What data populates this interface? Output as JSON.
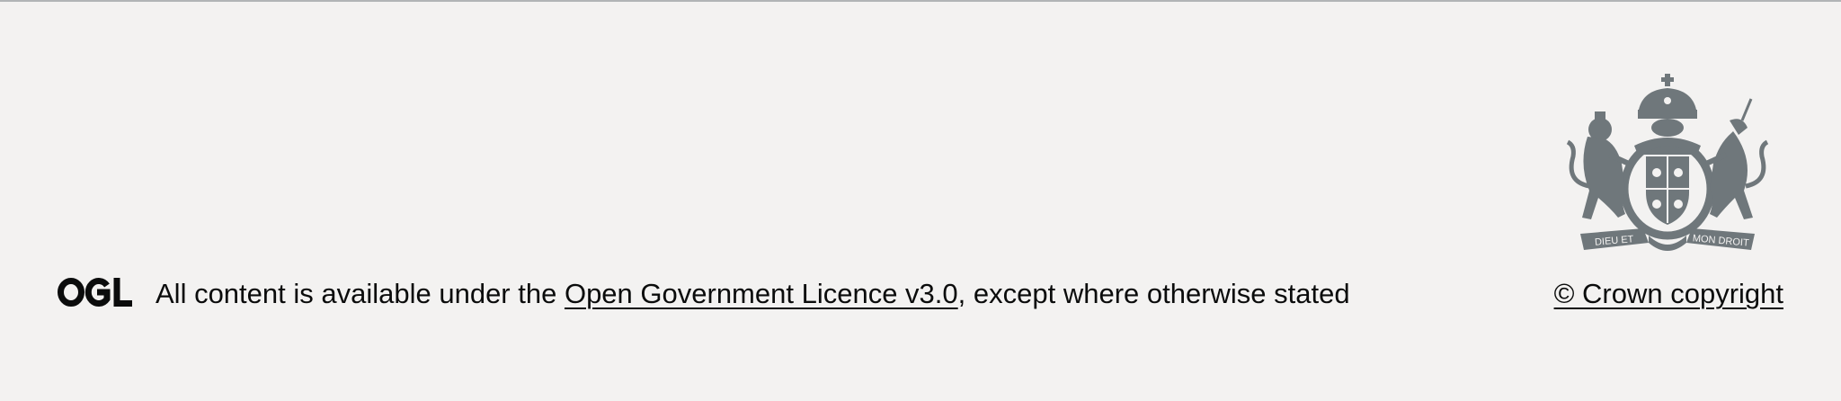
{
  "footer": {
    "ogl_logo_text": "OGL",
    "licence_prefix": "All content is available under the ",
    "licence_link": "Open Government Licence v3.0",
    "licence_suffix": ", except where otherwise stated",
    "crest_motto_left": "DIEU ET",
    "crest_motto_right": "MON DROIT",
    "copyright_link": "© Crown copyright"
  },
  "colors": {
    "background": "#f3f2f1",
    "text": "#0b0c0c",
    "border": "#b1b4b6",
    "crest": "#6f777b"
  },
  "icons": [
    "ogl-logo-icon",
    "royal-coat-of-arms-icon"
  ]
}
